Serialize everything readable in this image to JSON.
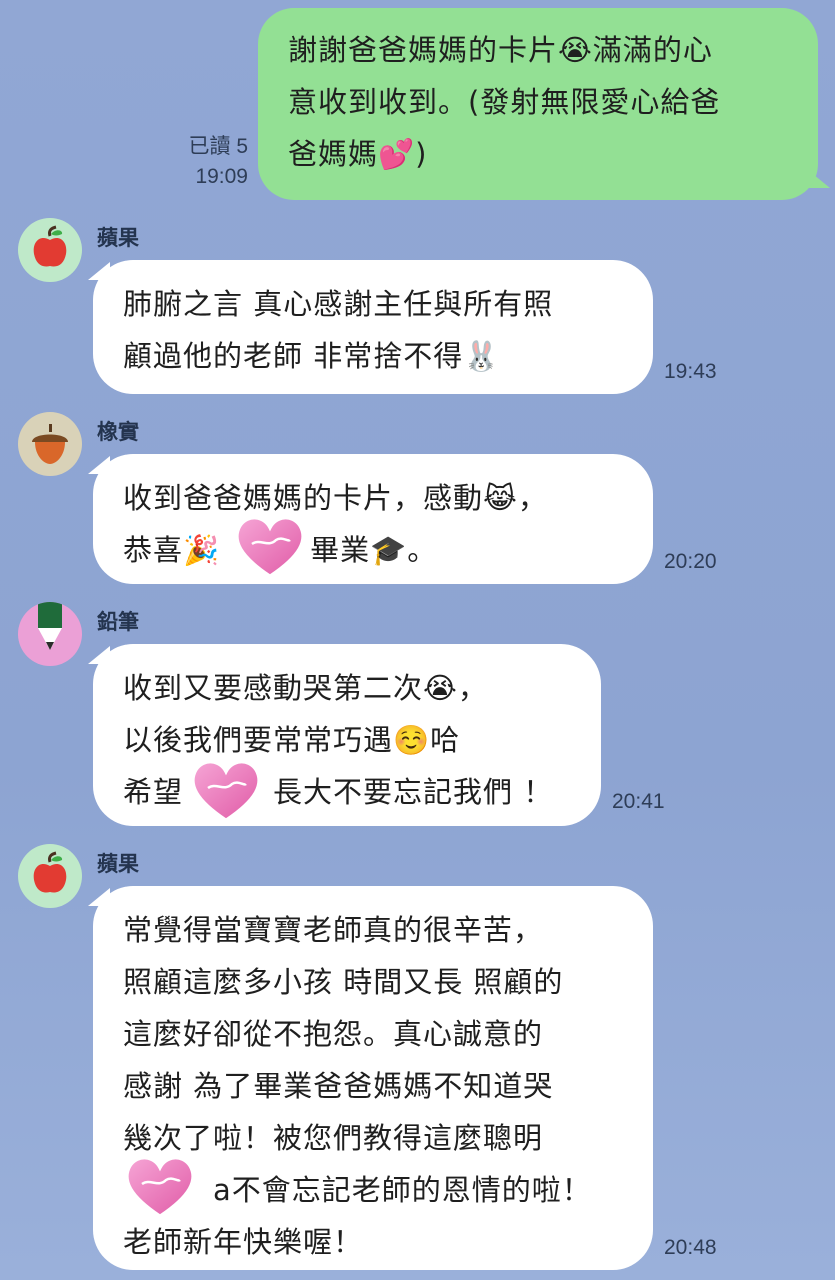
{
  "messages": {
    "m1": {
      "text": "謝謝爸爸媽媽的卡片😭滿滿的心\n意收到收到。(發射無限愛心給爸\n爸媽媽💕)",
      "read": "已讀 5",
      "time": "19:09"
    },
    "m2": {
      "sender": "蘋果",
      "text": "肺腑之言 真心感謝主任與所有照\n顧過他的老師 非常捨不得🐰",
      "time": "19:43"
    },
    "m3": {
      "sender": "橡實",
      "text": "收到爸爸媽媽的卡片，感動😹，\n恭喜🎉　　　畢業🎓。",
      "time": "20:20"
    },
    "m4": {
      "sender": "鉛筆",
      "text": "收到又要感動哭第二次😭，\n以後我們要常常巧遇☺️哈\n希望　　　長大不要忘記我們 ！",
      "time": "20:41"
    },
    "m5": {
      "sender": "蘋果",
      "text": "常覺得當寶寶老師真的很辛苦，\n照顧這麼多小孩 時間又長 照顧的\n這麼好卻從不抱怨。真心誠意的\n感謝 為了畢業爸爸媽媽不知道哭\n幾次了啦！被您們教得這麼聰明\n　　　a不會忘記老師的恩情的啦！\n老師新年快樂喔！",
      "time": "20:48"
    }
  },
  "icons": {
    "apple": "apple-icon",
    "acorn": "acorn-icon",
    "pencil": "pencil-icon",
    "sticker": "heart-sticker-icon"
  },
  "colors": {
    "background": "#8ea5d3",
    "my_bubble": "#93e094",
    "their_bubble": "#ffffff"
  }
}
